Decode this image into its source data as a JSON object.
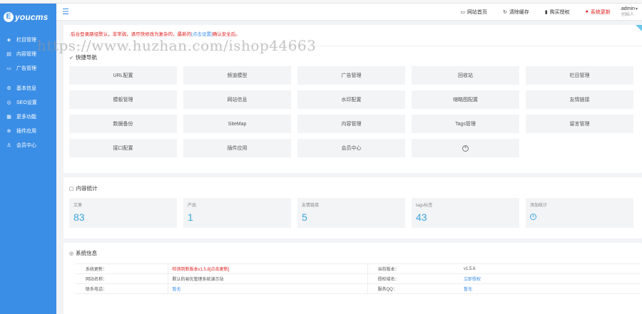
{
  "brand": {
    "mark": "E",
    "name": "youcms"
  },
  "sidebar": {
    "items": [
      {
        "label": "栏目管理",
        "icon": "grid-icon"
      },
      {
        "label": "内容管理",
        "icon": "document-icon"
      },
      {
        "label": "广告管理",
        "icon": "ad-icon"
      },
      {
        "label": "基本信息",
        "icon": "settings-icon"
      },
      {
        "label": "SEO设置",
        "icon": "seo-icon"
      },
      {
        "label": "更多功能",
        "icon": "apps-icon"
      },
      {
        "label": "插件应用",
        "icon": "plugin-icon"
      },
      {
        "label": "会员中心",
        "icon": "user-icon"
      }
    ]
  },
  "topbar": {
    "actions": [
      {
        "label": "网站首页",
        "icon": "monitor-icon"
      },
      {
        "label": "清除缓存",
        "icon": "refresh-icon"
      },
      {
        "label": "购买授权",
        "icon": "bookmark-icon"
      },
      {
        "label": "系统更新",
        "icon": "alert-icon"
      }
    ],
    "user": {
      "name": "admin",
      "role": "创始人"
    }
  },
  "notice": {
    "text": "·后台登录路径默认，非常弱，请尽快修改为复杂的，最新的",
    "link": "[点击设置]",
    "suffix": "确认安全后。"
  },
  "watermark": "https://www.huzhan.com/ishop44663",
  "quicknav": {
    "title": "快捷导航",
    "items": [
      "URL配置",
      "频道模型",
      "广告管理",
      "回收站",
      "栏目管理",
      "模板管理",
      "网站信息",
      "水印配置",
      "缩略图配置",
      "友情链接",
      "数据备份",
      "SiteMap",
      "内容管理",
      "Tags管理",
      "留言管理",
      "接口配置",
      "插件应用",
      "会员中心"
    ]
  },
  "stats": {
    "title": "内容统计",
    "items": [
      {
        "label": "文章",
        "value": "83"
      },
      {
        "label": "产品",
        "value": "1"
      },
      {
        "label": "友情链接",
        "value": "5"
      },
      {
        "label": "tags标签",
        "value": "43"
      },
      {
        "label": "添加统计",
        "value": ""
      }
    ]
  },
  "sysinfo": {
    "title": "系统信息",
    "rows": [
      {
        "k1": "系统更新：",
        "v1": "检测到新版本v1.5.8[点击更新]",
        "k2": "当前版本：",
        "v2": "v1.5.6"
      },
      {
        "k1": "网站名称：",
        "v1": "默认的易优管理系统演示站",
        "k2": "授权域名：",
        "v2": "立即授权"
      },
      {
        "k1": "联系电话：",
        "v1": "暂无",
        "k2": "服务QQ：",
        "v2": "暂无"
      }
    ]
  },
  "colors": {
    "sidebar": "#3b8ee6",
    "accent": "#3aa6e0",
    "danger": "#e02020"
  }
}
